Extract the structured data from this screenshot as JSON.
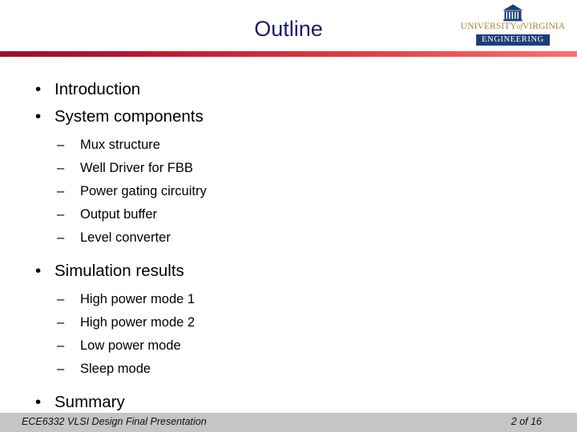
{
  "slide": {
    "title": "Outline"
  },
  "logo": {
    "icon_name": "uva-rotunda-icon",
    "wordmark_prefix": "UNIVERSITY",
    "wordmark_of": "of",
    "wordmark_suffix": "VIRGINIA",
    "badge": "ENGINEERING"
  },
  "colors": {
    "title": "#1b1b6e",
    "divider_start": "#98102b",
    "divider_end": "#f87272",
    "badge_bg": "#1b3f77",
    "wordmark": "#b08437",
    "footer_bg": "#c5c5c5"
  },
  "content": {
    "bullet_marker_l1": "•",
    "bullet_marker_l2": "–",
    "items": [
      {
        "level": 1,
        "text": "Introduction"
      },
      {
        "level": 1,
        "text": "System components"
      },
      {
        "level": 2,
        "text": "Mux structure"
      },
      {
        "level": 2,
        "text": "Well Driver for FBB"
      },
      {
        "level": 2,
        "text": "Power gating circuitry"
      },
      {
        "level": 2,
        "text": "Output buffer"
      },
      {
        "level": 2,
        "text": "Level converter"
      },
      {
        "level": 1,
        "text": "Simulation results"
      },
      {
        "level": 2,
        "text": "High power mode 1"
      },
      {
        "level": 2,
        "text": "High power mode 2"
      },
      {
        "level": 2,
        "text": "Low power mode"
      },
      {
        "level": 2,
        "text": "Sleep mode"
      },
      {
        "level": 1,
        "text": "Summary"
      }
    ]
  },
  "footer": {
    "left": "ECE6332 VLSI Design Final Presentation",
    "right": "2 of  16"
  }
}
